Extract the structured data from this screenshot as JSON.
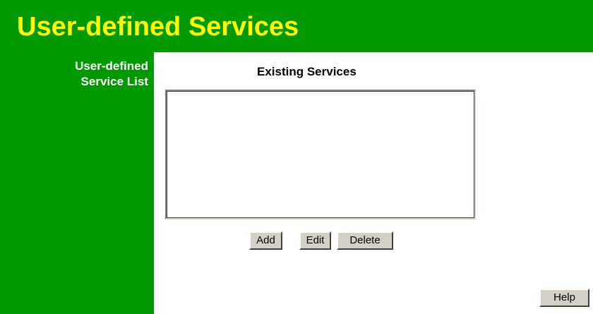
{
  "header": {
    "title": "User-defined Services"
  },
  "sidebar": {
    "label_line1": "User-defined",
    "label_line2": "Service List"
  },
  "main": {
    "heading": "Existing Services",
    "service_list": {
      "items": []
    },
    "buttons": {
      "add_label": "Add",
      "edit_label": "Edit",
      "delete_label": "Delete",
      "help_label": "Help"
    }
  },
  "colors": {
    "header_bg": "#009900",
    "title_text": "#ffff00",
    "sidebar_text": "#ffffff",
    "button_face": "#d4d0c8"
  }
}
